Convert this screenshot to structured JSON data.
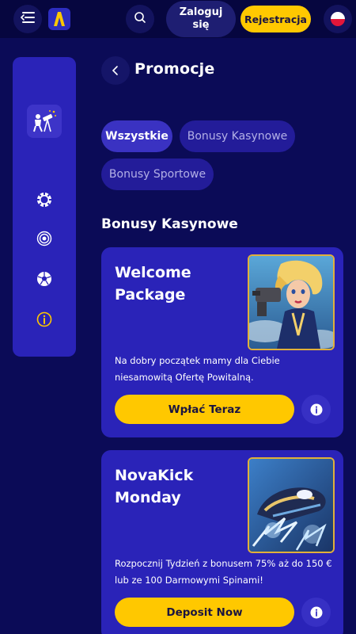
{
  "header": {
    "login_label": "Zaloguj się",
    "register_label": "Rejestracja",
    "menu_icon": "menu-icon",
    "logo": "logo-a",
    "search_icon": "search-icon",
    "language_flag": "flag-pl"
  },
  "sidebar": {
    "items": [
      {
        "icon": "telescope-icon"
      },
      {
        "icon": "poker-chip-icon"
      },
      {
        "icon": "target-icon"
      },
      {
        "icon": "football-icon"
      },
      {
        "icon": "info-icon"
      }
    ]
  },
  "page": {
    "title": "Promocje",
    "back_icon": "chevron-left-icon"
  },
  "filters": [
    {
      "label": "Wszystkie",
      "active": true
    },
    {
      "label": "Bonusy Kasynowe",
      "active": false
    },
    {
      "label": "Bonusy Sportowe",
      "active": false
    }
  ],
  "section": {
    "title": "Bonusy Kasynowe"
  },
  "promos": [
    {
      "title": "Welcome Package",
      "description": "Na dobry początek mamy dla Ciebie niesamowitą Ofertę Powitalną.",
      "cta": "Wpłać Teraz",
      "image": "blonde-pilot-illustration"
    },
    {
      "title": "NovaKick Monday",
      "description": "Rozpocznij Tydzień z bonusem 75% aż do 150 € lub ze 100 Darmowymi Spinami!",
      "cta": "Deposit Now",
      "image": "lightning-boot-illustration"
    }
  ],
  "colors": {
    "background": "#0b0b57",
    "header": "#06063f",
    "card": "#2a23b8",
    "accent": "#ffc800"
  }
}
